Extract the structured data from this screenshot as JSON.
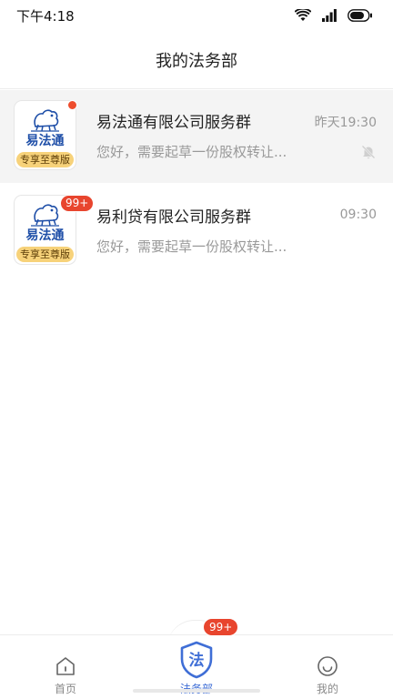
{
  "status_bar": {
    "time": "下午4:18",
    "icons": [
      "wifi-icon",
      "cellular-signal-icon",
      "battery-icon"
    ]
  },
  "header": {
    "title": "我的法务部"
  },
  "chats": [
    {
      "name": "易法通有限公司服务群",
      "time": "昨天19:30",
      "preview": "您好，需要起草一份股权转让...",
      "avatar_logo_text": "易法通",
      "avatar_badge": "专享至尊版",
      "unread": "dot",
      "muted": true,
      "highlighted": true
    },
    {
      "name": "易利贷有限公司服务群",
      "time": "09:30",
      "preview": "您好，需要起草一份股权转让...",
      "avatar_logo_text": "易法通",
      "avatar_badge": "专享至尊版",
      "unread": "99+",
      "muted": false,
      "highlighted": false
    }
  ],
  "tabbar": {
    "tabs": [
      {
        "label": "首页",
        "icon": "home-icon",
        "selected": false
      },
      {
        "label": "法务部",
        "icon": "law-shield-icon",
        "icon_text": "法",
        "selected": true,
        "badge": "99+"
      },
      {
        "label": "我的",
        "icon": "smiley-profile-icon",
        "selected": false
      }
    ]
  },
  "colors": {
    "accent": "#3f6ed6",
    "badge_red": "#e8452e",
    "tier_gold": "#f7d27a",
    "logo_blue": "#1f4fa8"
  }
}
